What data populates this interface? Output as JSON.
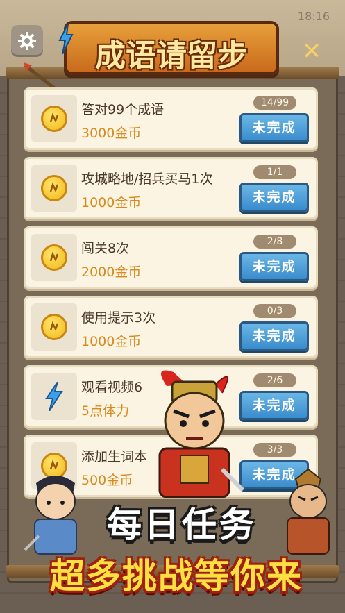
{
  "status_bar": {
    "time": "18:16"
  },
  "header": {
    "title": "成语请留步",
    "close_symbol": "✕",
    "settings_icon": "gear-icon"
  },
  "tasks": [
    {
      "label": "答对99个成语",
      "reward": "3000金币",
      "progress": "14/99",
      "status": "未完成",
      "icon": "coin-icon"
    },
    {
      "label": "攻城略地/招兵买马1次",
      "reward": "1000金币",
      "progress": "1/1",
      "status": "未完成",
      "icon": "coin-icon"
    },
    {
      "label": "闯关8次",
      "reward": "2000金币",
      "progress": "2/8",
      "status": "未完成",
      "icon": "coin-icon"
    },
    {
      "label": "使用提示3次",
      "reward": "1000金币",
      "progress": "0/3",
      "status": "未完成",
      "icon": "coin-icon"
    },
    {
      "label": "观看视频6",
      "reward": "5点体力",
      "progress": "2/6",
      "status": "未完成",
      "icon": "lightning-icon"
    },
    {
      "label": "添加生词本",
      "reward": "500金币",
      "progress": "3/3",
      "status": "未完成",
      "icon": "coin-icon"
    }
  ],
  "promo": {
    "line1": "每日任务",
    "line2": "超多挑战等你来"
  },
  "colors": {
    "button_blue": "#3a8ccc",
    "reward_orange": "#d98a1e",
    "title_orange": "#c96a1c"
  }
}
